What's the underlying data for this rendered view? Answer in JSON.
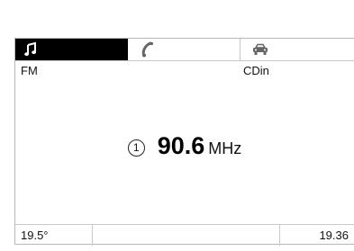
{
  "tabs": [
    {
      "id": "audio",
      "icon": "music-note-icon",
      "active": true
    },
    {
      "id": "phone",
      "icon": "phone-handset-icon",
      "active": false
    },
    {
      "id": "navigation",
      "icon": "car-icon",
      "active": false
    }
  ],
  "source": {
    "band": "FM",
    "aux_source": "CDin"
  },
  "tuner": {
    "preset": "1",
    "frequency": "90.6",
    "unit": "MHz"
  },
  "status": {
    "temperature": "19.5°",
    "middle": "",
    "time": "19.36"
  },
  "colors": {
    "active_tab_bg": "#000000",
    "active_tab_icon": "#ffffff",
    "inactive_icon": "#555555",
    "divider": "#c8c8c8"
  }
}
